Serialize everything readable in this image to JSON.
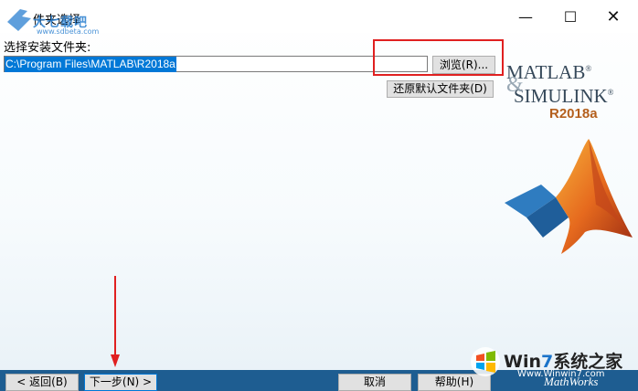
{
  "watermark_top": {
    "text": "大七载吧",
    "url": "www.sdbeta.com"
  },
  "window": {
    "title": "件夹选择",
    "minimize_glyph": "—",
    "maximize_glyph": "☐",
    "close_glyph": "✕"
  },
  "form": {
    "label": "选择安装文件夹:",
    "path_value": "C:\\Program Files\\MATLAB\\R2018a",
    "browse_label": "浏览(R)...",
    "restore_label": "还原默认文件夹(D)"
  },
  "brand": {
    "line1": "MATLAB",
    "line2": "SIMULINK",
    "ampersand": "&",
    "registered": "®",
    "release": "R2018a",
    "footer": "MathWorks"
  },
  "footer_buttons": {
    "back": "< 返回(B)",
    "next": "下一步(N) >",
    "cancel": "取消",
    "help": "帮助(H)"
  },
  "watermark_bottom": {
    "win": "Win",
    "seven": "7",
    "rest": "系统之家",
    "url": "Www.Winwin7.com"
  },
  "colors": {
    "accent": "#0078d7",
    "bottom_bar": "#1e5d91",
    "highlight_box": "#e02020",
    "release": "#b45f1c"
  }
}
